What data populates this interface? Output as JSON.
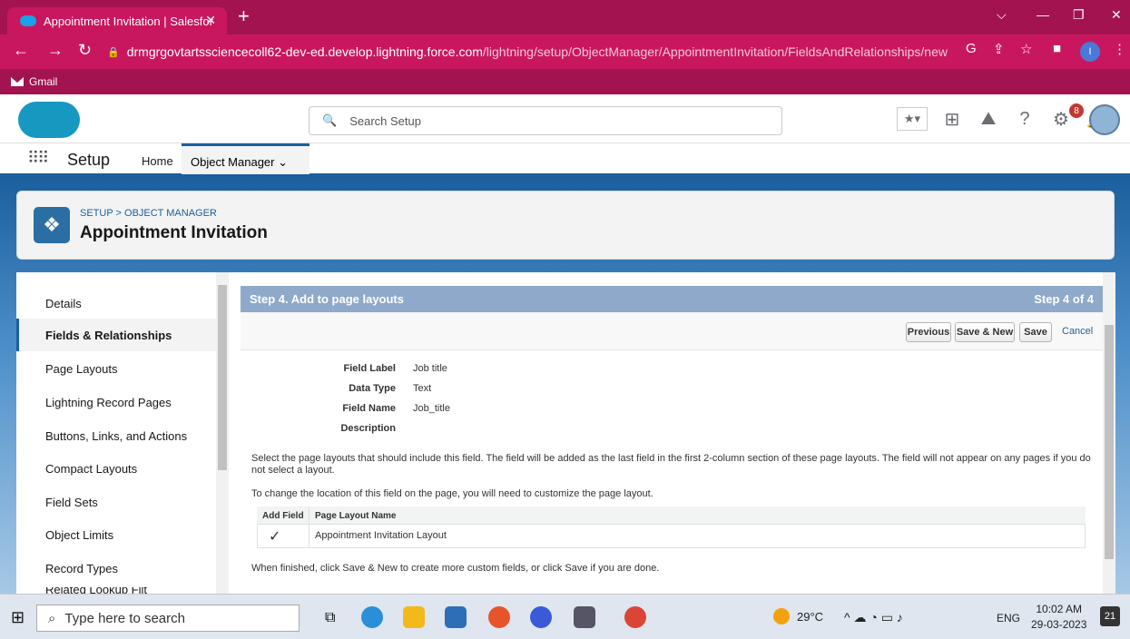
{
  "browser": {
    "tab_title": "Appointment Invitation | Salesfor",
    "url_host": "drmgrgovtartssciencecoll62-dev-ed.develop.lightning.force.com",
    "url_path": "/lightning/setup/ObjectManager/AppointmentInvitation/FieldsAndRelationships/new",
    "bookmark": "Gmail",
    "profile_initial": "I"
  },
  "header": {
    "search_placeholder": "Search Setup",
    "notif_count": "8"
  },
  "nav": {
    "app": "Setup",
    "home": "Home",
    "object_manager": "Object Manager"
  },
  "page": {
    "breadcrumb": "SETUP > OBJECT MANAGER",
    "title": "Appointment Invitation"
  },
  "sidebar": {
    "items": [
      "Details",
      "Fields & Relationships",
      "Page Layouts",
      "Lightning Record Pages",
      "Buttons, Links, and Actions",
      "Compact Layouts",
      "Field Sets",
      "Object Limits",
      "Record Types",
      "Related Lookup Filt"
    ]
  },
  "step": {
    "title": "Step 4. Add to page layouts",
    "progress": "Step 4 of 4",
    "previous": "Previous",
    "save_new": "Save & New",
    "save": "Save",
    "cancel": "Cancel"
  },
  "fields": {
    "label_k": "Field Label",
    "label_v": "Job title",
    "type_k": "Data Type",
    "type_v": "Text",
    "name_k": "Field Name",
    "name_v": "Job_title",
    "desc_k": "Description"
  },
  "text": {
    "p1": "Select the page layouts that should include this field. The field will be added as the last field in the first 2-column section of these page layouts. The field will not appear on any pages if you do not select a layout.",
    "p2": "To change the location of this field on the page, you will need to customize the page layout.",
    "p3": "When finished, click Save & New to create more custom fields, or click Save if you are done."
  },
  "table": {
    "col1": "Add Field",
    "col2": "Page Layout Name",
    "row_check": "✓",
    "row_name": "Appointment Invitation Layout"
  },
  "taskbar": {
    "search": "Type here to search",
    "temp": "29°C",
    "lang": "ENG",
    "time": "10:02 AM",
    "date": "29-03-2023",
    "notif": "21"
  }
}
